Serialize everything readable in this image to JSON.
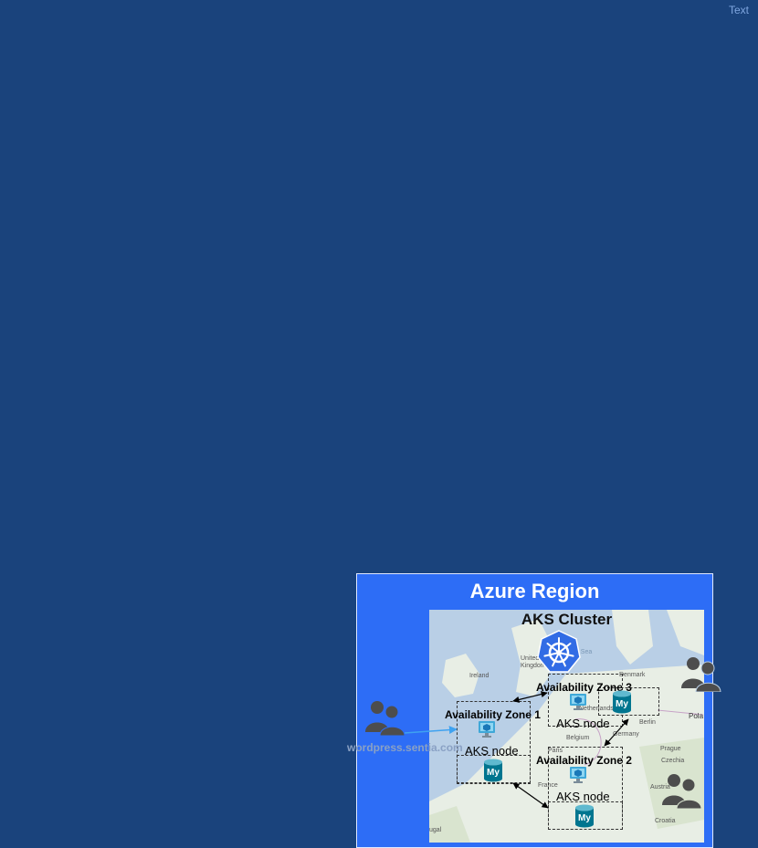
{
  "corner_text": "Text",
  "region": {
    "title": "Azure Region"
  },
  "cluster": {
    "title": "AKS Cluster"
  },
  "zones": [
    {
      "title": "Availability Zone 1",
      "node_label": "AKS node"
    },
    {
      "title": "Availability Zone 2",
      "node_label": "AKS node"
    },
    {
      "title": "Availability Zone 3",
      "node_label": "AKS node"
    }
  ],
  "url": "wordpress.sentia.com",
  "map_labels": {
    "ireland": "Ireland",
    "united_kingdom": "United Kingdom",
    "denmark": "Denmark",
    "netherlands": "Netherlands",
    "belgium": "Belgium",
    "germany": "Germany",
    "berlin": "Berlin",
    "poland": "Pola",
    "paris": "Paris",
    "france": "France",
    "czechia": "Czechia",
    "prague": "Prague",
    "austria": "Austria",
    "croatia": "Croatia",
    "portugal": "ugal",
    "north_sea": "th Sea"
  },
  "colors": {
    "background": "#1a437c",
    "region_fill": "#2d6df6",
    "kubernetes": "#326ce5",
    "mysql": "#00758f",
    "users": "#4d4d4d"
  }
}
